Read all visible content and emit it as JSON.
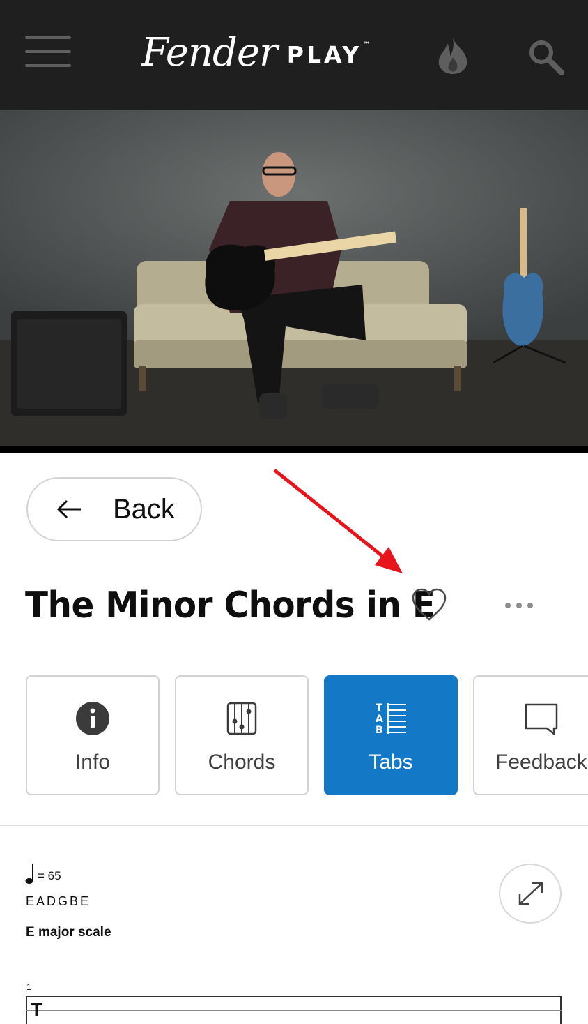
{
  "header": {
    "logo_script": "Fender",
    "logo_play": "PLAY",
    "logo_tm": "™",
    "icons": [
      "menu-icon",
      "flame-icon",
      "search-icon"
    ],
    "background": "#1f1f1f"
  },
  "back": {
    "label": "Back"
  },
  "lesson": {
    "title": "The Minor Chords in E"
  },
  "tabs": [
    {
      "label": "Info",
      "icon": "info-icon",
      "active": false
    },
    {
      "label": "Chords",
      "icon": "chord-diagram-icon",
      "active": false
    },
    {
      "label": "Tabs",
      "icon": "tab-icon",
      "active": true
    },
    {
      "label": "Feedback",
      "icon": "speech-bubble-icon",
      "active": false
    }
  ],
  "sheet": {
    "tempo": "= 65",
    "tuning": "EADGBE",
    "scale_title": "E major scale",
    "measure_number": "1",
    "clef": "T"
  },
  "colors": {
    "accent": "#1378c5",
    "annotation": "#e8141c"
  }
}
